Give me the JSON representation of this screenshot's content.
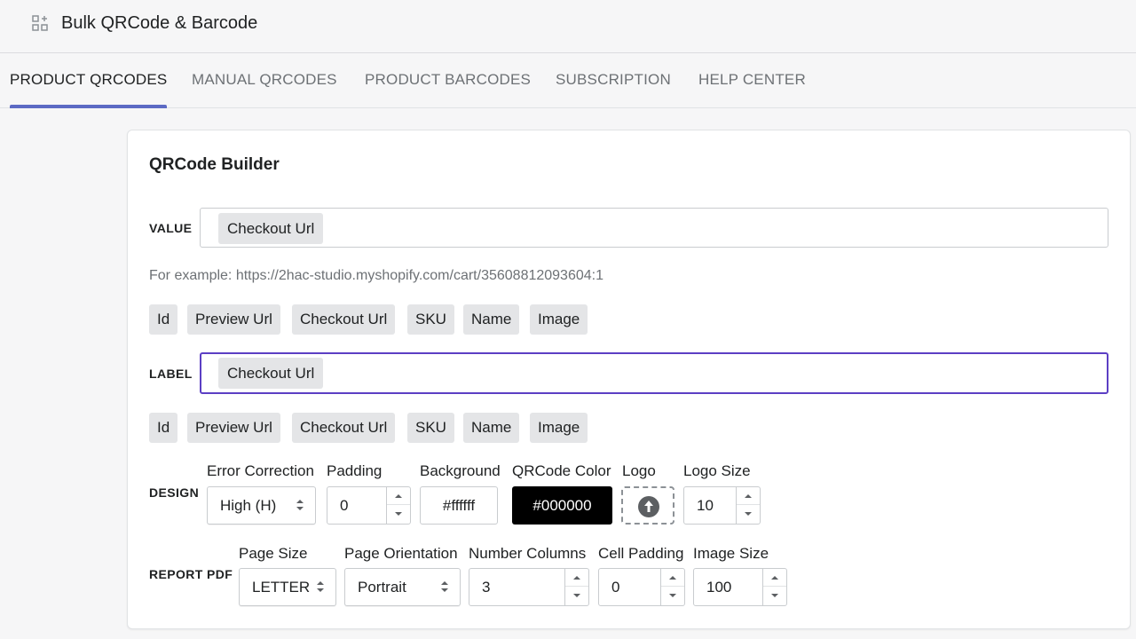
{
  "app": {
    "title": "Bulk QRCode & Barcode",
    "icon": "grid-plus-icon"
  },
  "tabs": [
    {
      "label": "PRODUCT QRCODES",
      "active": true
    },
    {
      "label": "MANUAL QRCODES",
      "active": false
    },
    {
      "label": "PRODUCT BARCODES",
      "active": false
    },
    {
      "label": "SUBSCRIPTION",
      "active": false
    },
    {
      "label": "HELP CENTER",
      "active": false
    }
  ],
  "builder": {
    "title": "QRCode Builder",
    "value": {
      "label": "VALUE",
      "tag": "Checkout Url",
      "example": "For example: https://2hac-studio.myshopify.com/cart/35608812093604:1",
      "chips": [
        "Id",
        "Preview Url",
        "Checkout Url",
        "SKU",
        "Name",
        "Image"
      ]
    },
    "label_field": {
      "label": "LABEL",
      "tag": "Checkout Url",
      "chips": [
        "Id",
        "Preview Url",
        "Checkout Url",
        "SKU",
        "Name",
        "Image"
      ]
    },
    "design": {
      "label": "DESIGN",
      "error_correction": {
        "label": "Error Correction",
        "value": "High (H)"
      },
      "padding": {
        "label": "Padding",
        "value": "0"
      },
      "background": {
        "label": "Background",
        "value": "#ffffff"
      },
      "qrcode_color": {
        "label": "QRCode Color",
        "value": "#000000"
      },
      "logo": {
        "label": "Logo",
        "icon": "upload-arrow-icon"
      },
      "logo_size": {
        "label": "Logo Size",
        "value": "10"
      }
    },
    "report_pdf": {
      "label": "REPORT PDF",
      "page_size": {
        "label": "Page Size",
        "value": "LETTER"
      },
      "page_orientation": {
        "label": "Page Orientation",
        "value": "Portrait"
      },
      "number_columns": {
        "label": "Number Columns",
        "value": "3"
      },
      "cell_padding": {
        "label": "Cell Padding",
        "value": "0"
      },
      "image_size": {
        "label": "Image Size",
        "value": "100"
      }
    }
  },
  "colors": {
    "accent": "#5c6ac4",
    "focus": "#5c3fc4",
    "chip_bg": "#e4e5e7"
  }
}
